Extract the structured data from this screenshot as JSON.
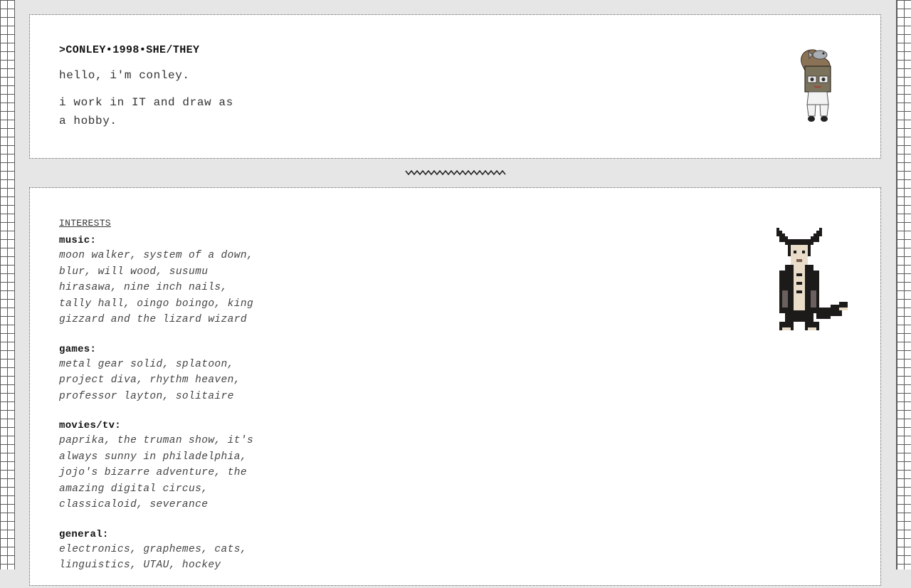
{
  "profile": {
    "heading": ">CONLEY•1998•SHE/THEY",
    "greeting": "hello, i'm conley.",
    "bio": "i work in IT and draw as a hobby."
  },
  "interests": {
    "title": "INTERESTS",
    "categories": [
      {
        "label": "music:",
        "items": "moon walker, system of a down, blur, will wood, susumu hirasawa, nine inch nails, tally hall, oingo boingo, king gizzard and the lizard wizard"
      },
      {
        "label": "games:",
        "items": "metal gear solid, splatoon, project diva, rhythm heaven, professor layton, solitaire"
      },
      {
        "label": "movies/tv:",
        "items": "paprika, the truman show, it's always sunny in philadelphia, jojo's bizarre adventure, the amazing digital circus, classicaloid, severance"
      },
      {
        "label": "general:",
        "items": "electronics, graphemes, cats, linguistics, UTAU, hockey"
      }
    ]
  },
  "colors": {
    "page_background": "#e6e6e6",
    "card_background": "#ffffff",
    "grid_line": "#5a5a5a",
    "text": "#222222"
  },
  "icons": {
    "top_avatar": "chibi-character-with-box-head-and-fish-hat",
    "pixel_avatar": "pixel-art-black-and-white-dog-creature",
    "divider": "zigzag-divider"
  }
}
